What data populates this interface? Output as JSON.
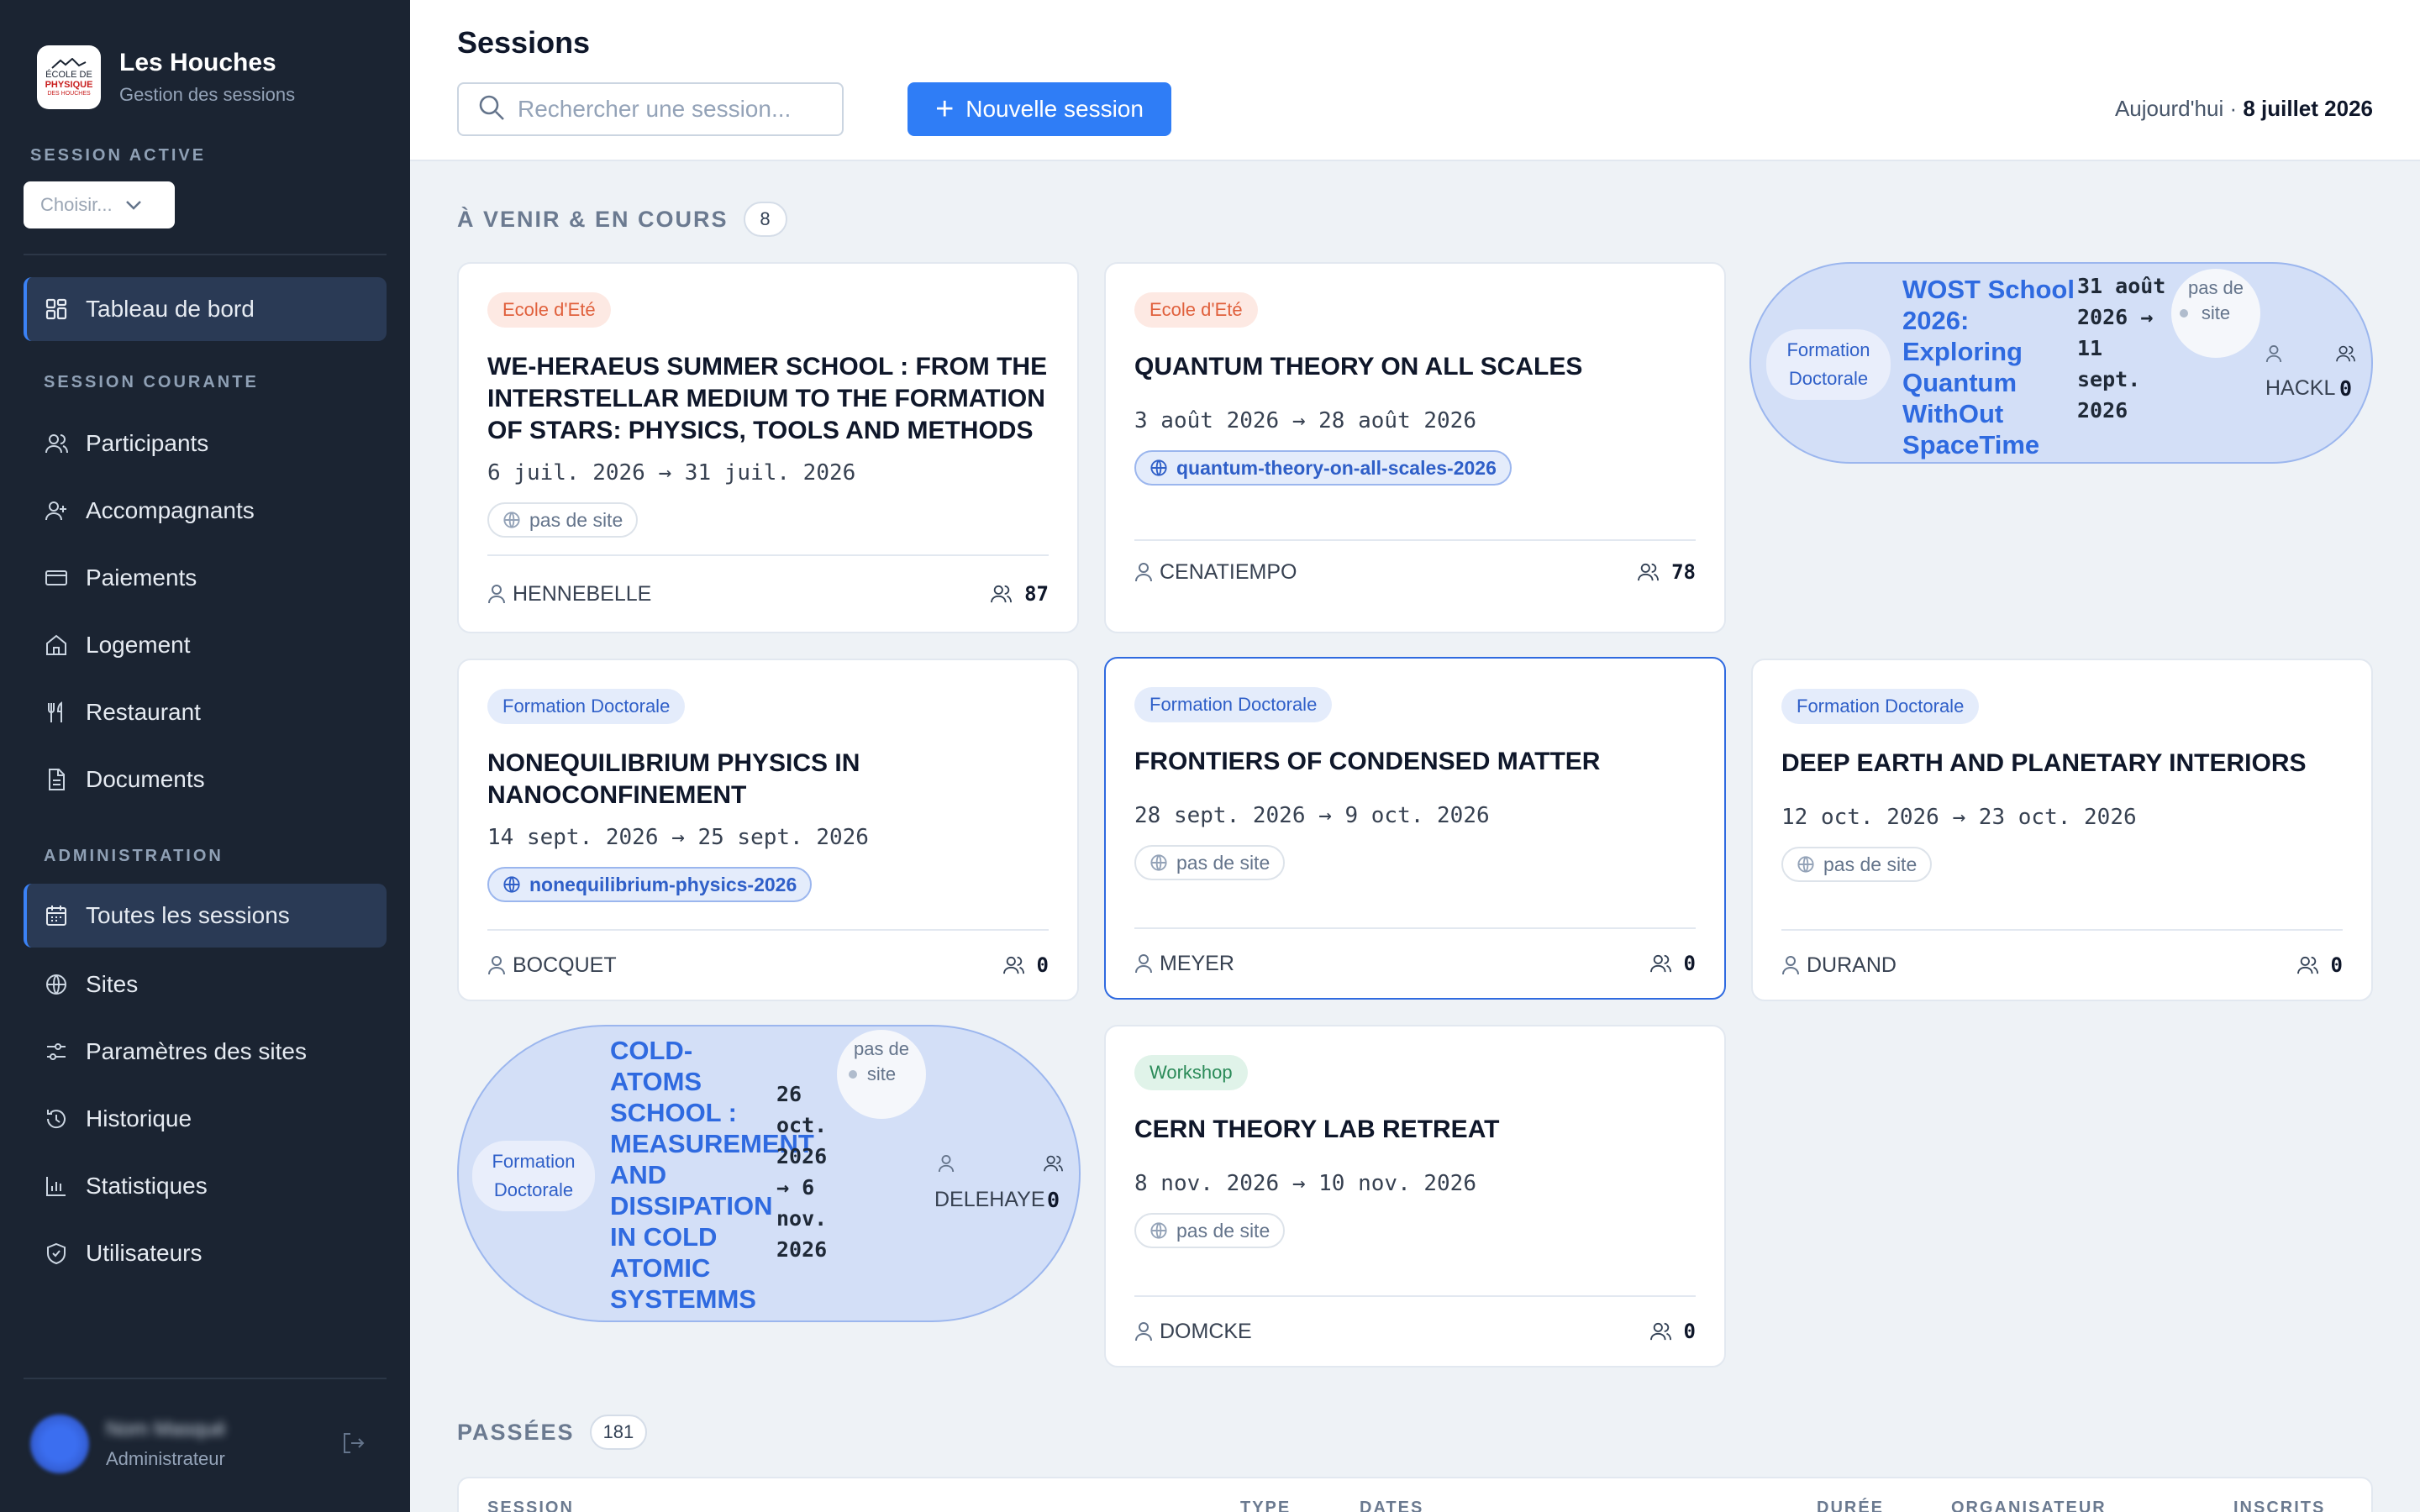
{
  "app": {
    "name": "Les Houches",
    "subtitle": "Gestion des sessions",
    "logo_lines": [
      "ÉCOLE DE",
      "PHYSIQUE",
      "DES HOUCHES"
    ]
  },
  "sidebar": {
    "session_active_label": "SESSION ACTIVE",
    "session_select_placeholder": "Choisir...",
    "dashboard_label": "Tableau de bord",
    "current_session_heading": "SESSION COURANTE",
    "current_items": [
      {
        "label": "Participants",
        "icon": "users-icon"
      },
      {
        "label": "Accompagnants",
        "icon": "user-plus-icon"
      },
      {
        "label": "Paiements",
        "icon": "credit-card-icon"
      },
      {
        "label": "Logement",
        "icon": "home-icon"
      },
      {
        "label": "Restaurant",
        "icon": "utensils-icon"
      },
      {
        "label": "Documents",
        "icon": "document-icon"
      }
    ],
    "admin_heading": "ADMINISTRATION",
    "admin_items": [
      {
        "label": "Toutes les sessions",
        "icon": "calendar-icon"
      },
      {
        "label": "Sites",
        "icon": "globe-icon"
      },
      {
        "label": "Paramètres des sites",
        "icon": "sliders-icon"
      },
      {
        "label": "Historique",
        "icon": "history-icon"
      },
      {
        "label": "Statistiques",
        "icon": "bar-chart-icon"
      },
      {
        "label": "Utilisateurs",
        "icon": "shield-icon"
      }
    ],
    "user": {
      "name": "Nom Masqué",
      "role": "Administrateur"
    }
  },
  "header": {
    "title": "Sessions",
    "search_placeholder": "Rechercher une session...",
    "new_session_label": "Nouvelle session",
    "today_prefix": "Aujourd'hui · ",
    "today_date": "8 juillet 2026"
  },
  "upcoming": {
    "title": "À VENIR & EN COURS",
    "count": "8",
    "cards": [
      {
        "type": "Ecole d'Eté",
        "title": "WE-HERAEUS SUMMER SCHOOL : FROM THE INTERSTELLAR MEDIUM TO THE FORMATION OF STARS: PHYSICS, TOOLS AND METHODS",
        "dates": "6 juil. 2026 → 31 juil. 2026",
        "site": "pas de site",
        "organizer": "HENNEBELLE",
        "inscrits": "87"
      },
      {
        "type": "Ecole d'Eté",
        "title": "QUANTUM THEORY ON ALL SCALES",
        "dates": "3 août 2026 → 28 août 2026",
        "site": "quantum-theory-on-all-scales-2026",
        "organizer": "CENATIEMPO",
        "inscrits": "78"
      },
      {
        "type": "Formation Doctorale",
        "title": "WOST School 2026: Exploring Quantum WithOut SpaceTime",
        "dates": "31 août 2026 → 11 sept. 2026",
        "site": "pas de site",
        "organizer": "HACKL",
        "inscrits": "0"
      },
      {
        "type": "Formation Doctorale",
        "title": "NONEQUILIBRIUM PHYSICS IN NANOCONFINEMENT",
        "dates": "14 sept. 2026 → 25 sept. 2026",
        "site": "nonequilibrium-physics-2026",
        "organizer": "BOCQUET",
        "inscrits": "0"
      },
      {
        "type": "Formation Doctorale",
        "title": "FRONTIERS OF CONDENSED MATTER",
        "dates": "28 sept. 2026 → 9 oct. 2026",
        "site": "pas de site",
        "organizer": "MEYER",
        "inscrits": "0"
      },
      {
        "type": "Formation Doctorale",
        "title": "DEEP EARTH AND PLANETARY INTERIORS",
        "dates": "12 oct. 2026 → 23 oct. 2026",
        "site": "pas de site",
        "organizer": "DURAND",
        "inscrits": "0"
      },
      {
        "type": "Formation Doctorale",
        "title": "COLD-ATOMS SCHOOL : MEASUREMENT AND DISSIPATION IN COLD ATOMIC SYSTEMMS",
        "dates": "26 oct. 2026 → 6 nov. 2026",
        "site": "pas de site",
        "organizer": "DELEHAYE",
        "inscrits": "0"
      },
      {
        "type": "Workshop",
        "title": "CERN THEORY LAB RETREAT",
        "dates": "8 nov. 2026 → 10 nov. 2026",
        "site": "pas de site",
        "organizer": "DOMCKE",
        "inscrits": "0"
      }
    ]
  },
  "past": {
    "title": "PASSÉES",
    "count": "181",
    "columns": [
      "SESSION",
      "TYPE",
      "DATES",
      "DURÉE",
      "ORGANISATEUR",
      "INSCRITS"
    ]
  },
  "colors": {
    "sidebar_bg": "#1b2432",
    "accent": "#2f7df6",
    "ete_badge": "#e0603c",
    "doctorale_badge": "#2f5fc8",
    "workshop_badge": "#2a8a58"
  }
}
